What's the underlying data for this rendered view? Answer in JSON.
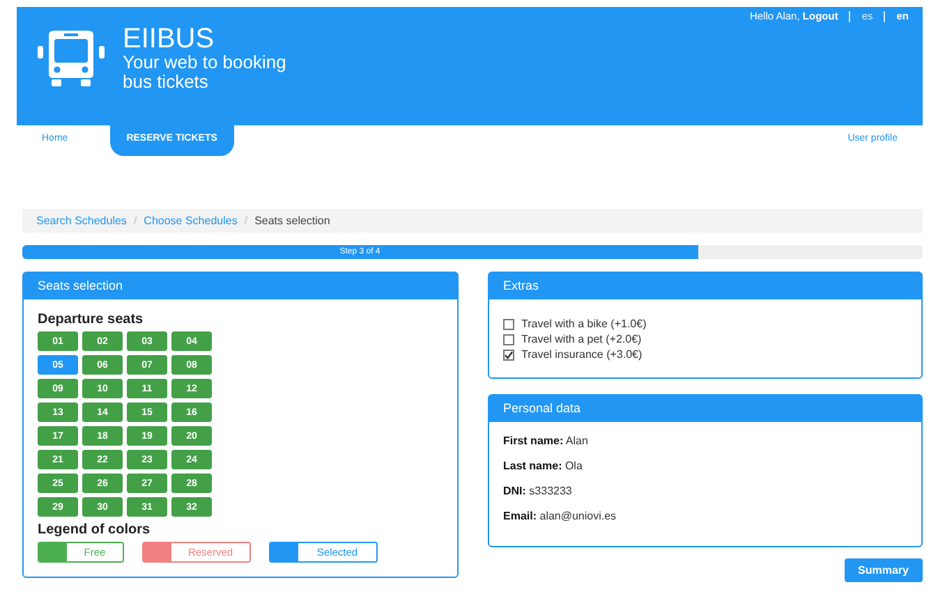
{
  "header": {
    "title": "EIIBUS",
    "tagline": "Your web to booking bus tickets",
    "greeting": "Hello Alan,",
    "logout": "Logout",
    "languages": [
      {
        "label": "es",
        "selected": false
      },
      {
        "label": "en",
        "selected": true
      }
    ]
  },
  "nav": [
    {
      "label": "Home",
      "selected": false
    },
    {
      "label": "RESERVE TICKETS",
      "selected": true
    },
    {
      "label": "User profile",
      "selected": false
    }
  ],
  "breadcrumb": {
    "separators": [
      "/",
      "/"
    ],
    "items": [
      {
        "label": "Search Schedules",
        "link": true
      },
      {
        "label": "Choose Schedules",
        "link": true
      },
      {
        "label": "Seats selection",
        "link": false
      }
    ]
  },
  "progress": {
    "label": "Step 3 of 4",
    "level": 0.75
  },
  "seats_panel": {
    "title": "Seats selection",
    "heading": "Departure seats",
    "seats": [
      {
        "label": "01",
        "selected": false
      },
      {
        "label": "02",
        "selected": false
      },
      {
        "label": "03",
        "selected": false
      },
      {
        "label": "04",
        "selected": false
      },
      {
        "label": "05",
        "selected": true
      },
      {
        "label": "06",
        "selected": false
      },
      {
        "label": "07",
        "selected": false
      },
      {
        "label": "08",
        "selected": false
      },
      {
        "label": "09",
        "selected": false
      },
      {
        "label": "10",
        "selected": false
      },
      {
        "label": "11",
        "selected": false
      },
      {
        "label": "12",
        "selected": false
      },
      {
        "label": "13",
        "selected": false
      },
      {
        "label": "14",
        "selected": false
      },
      {
        "label": "15",
        "selected": false
      },
      {
        "label": "16",
        "selected": false
      },
      {
        "label": "17",
        "selected": false
      },
      {
        "label": "18",
        "selected": false
      },
      {
        "label": "19",
        "selected": false
      },
      {
        "label": "20",
        "selected": false
      },
      {
        "label": "21",
        "selected": false
      },
      {
        "label": "22",
        "selected": false
      },
      {
        "label": "23",
        "selected": false
      },
      {
        "label": "24",
        "selected": false
      },
      {
        "label": "25",
        "selected": false
      },
      {
        "label": "26",
        "selected": false
      },
      {
        "label": "27",
        "selected": false
      },
      {
        "label": "28",
        "selected": false
      },
      {
        "label": "29",
        "selected": false
      },
      {
        "label": "30",
        "selected": false
      },
      {
        "label": "31",
        "selected": false
      },
      {
        "label": "32",
        "selected": false
      }
    ],
    "legend_title": "Legend of colors",
    "legend": [
      {
        "label": "Free",
        "color": "#4caf50"
      },
      {
        "label": "Reserved",
        "color": "#f28080"
      },
      {
        "label": "Selected",
        "color": "#2196f3"
      }
    ]
  },
  "extras_panel": {
    "title": "Extras",
    "options": [
      {
        "label": "Travel with a bike (+1.0€)",
        "checked": false
      },
      {
        "label": "Travel with a pet (+2.0€)",
        "checked": false
      },
      {
        "label": "Travel insurance (+3.0€)",
        "checked": true
      }
    ]
  },
  "personal_panel": {
    "title": "Personal data",
    "fields": [
      {
        "label": "First name:",
        "value": "Alan"
      },
      {
        "label": "Last name:",
        "value": "Ola"
      },
      {
        "label": "DNI:",
        "value": "s333233"
      },
      {
        "label": "Email:",
        "value": "alan@uniovi.es"
      }
    ]
  },
  "summary_button": "Summary"
}
